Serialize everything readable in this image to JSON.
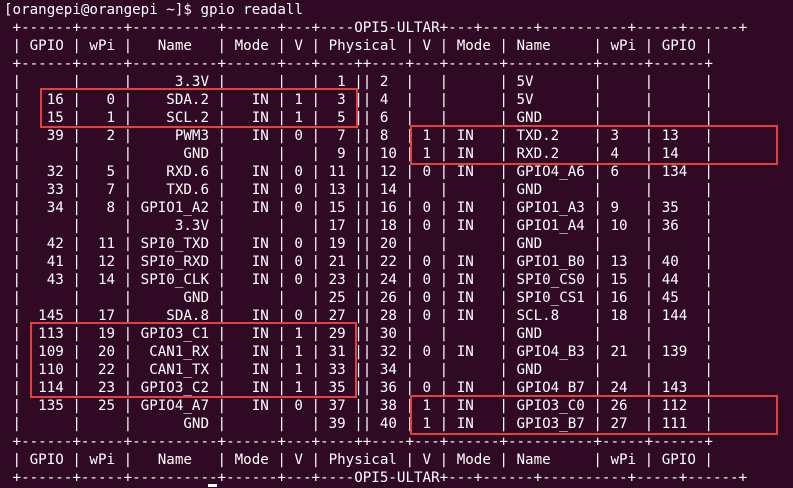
{
  "window": {
    "prompt": "[orangepi@orangepi ~]$ gpio readall"
  },
  "colors": {
    "background": "#300a24",
    "text": "#ffffff",
    "highlight": "#e3403f"
  },
  "table": {
    "border_top": " +------+-----+----------+------+---+----OPI5-ULTAR+---+------+----------+-----+------+",
    "header": " | GPIO | wPi |   Name   | Mode | V | Physical | V | Mode | Name     | wPi | GPIO |",
    "separator": " +------+-----+----------+------+---+----++----+---+------+----------+-----+------+",
    "rows": [
      " |      |     |     3.3V |      |   |  1 || 2  |   |      | 5V       |     |      |",
      " |   16 |   0 |    SDA.2 |   IN | 1 |  3 || 4  |   |      | 5V       |     |      |",
      " |   15 |   1 |    SCL.2 |   IN | 1 |  5 || 6  |   |      | GND      |     |      |",
      " |   39 |   2 |     PWM3 |   IN | 0 |  7 || 8  | 1 | IN   | TXD.2    | 3   | 13   |",
      " |      |     |      GND |      |   |  9 || 10 | 1 | IN   | RXD.2    | 4   | 14   |",
      " |   32 |   5 |    RXD.6 |   IN | 0 | 11 || 12 | 0 | IN   | GPIO4_A6 | 6   | 134  |",
      " |   33 |   7 |    TXD.6 |   IN | 0 | 13 || 14 |   |      | GND      |     |      |",
      " |   34 |   8 | GPIO1_A2 |   IN | 0 | 15 || 16 | 0 | IN   | GPIO1_A3 | 9   | 35   |",
      " |      |     |     3.3V |      |   | 17 || 18 | 0 | IN   | GPIO1_A4 | 10  | 36   |",
      " |   42 |  11 | SPI0_TXD |   IN | 0 | 19 || 20 |   |      | GND      |     |      |",
      " |   41 |  12 | SPI0_RXD |   IN | 0 | 21 || 22 | 0 | IN   | GPIO1_B0 | 13  | 40   |",
      " |   43 |  14 | SPI0_CLK |   IN | 0 | 23 || 24 | 0 | IN   | SPI0_CS0 | 15  | 44   |",
      " |      |     |      GND |      |   | 25 || 26 | 0 | IN   | SPI0_CS1 | 16  | 45   |",
      " |  145 |  17 |    SDA.8 |   IN | 0 | 27 || 28 | 0 | IN   | SCL.8    | 18  | 144  |",
      " |  113 |  19 | GPIO3_C1 |   IN | 1 | 29 || 30 |   |      | GND      |     |      |",
      " |  109 |  20 |  CAN1_RX |   IN | 1 | 31 || 32 | 0 | IN   | GPIO4_B3 | 21  | 139  |",
      " |  110 |  22 |  CAN1_TX |   IN | 1 | 33 || 34 |   |      | GND      |     |      |",
      " |  114 |  23 | GPIO3_C2 |   IN | 1 | 35 || 36 | 0 | IN   | GPIO4_B7 | 24  | 143  |",
      " |  135 |  25 | GPIO4_A7 |   IN | 0 | 37 || 38 | 1 | IN   | GPIO3_C0 | 26  | 112  |",
      " |      |     |      GND |      |   | 39 || 40 | 1 | IN   | GPIO3_B7 | 27  | 111  |"
    ],
    "footer_separator": " +------+-----+----------+------+---+----++----+---+------+----------+-----+------+",
    "footer": " | GPIO | wPi |   Name   | Mode | V | Physical | V | Mode | Name     | wPi | GPIO |",
    "border_bottom": " +------+-----+----------+------+---+----OPI5-ULTAR+---+------+----------+-----+------+"
  }
}
